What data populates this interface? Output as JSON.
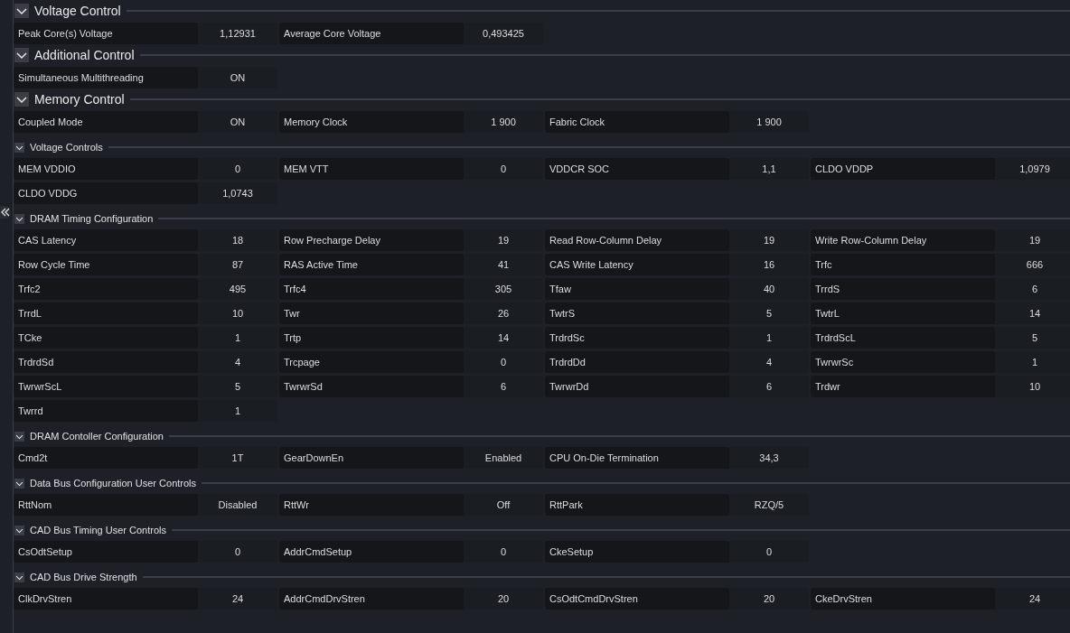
{
  "sections": [
    {
      "title": "Voltage Control",
      "kind": "major",
      "expanded": true,
      "items": [
        {
          "label": "Peak Core(s) Voltage",
          "value": "1,12931"
        },
        {
          "label": "Average Core Voltage",
          "value": "0,493425"
        }
      ]
    },
    {
      "title": "Additional Control",
      "kind": "major",
      "expanded": true,
      "items": [
        {
          "label": "Simultaneous Multithreading",
          "value": "ON"
        }
      ]
    },
    {
      "title": "Memory Control",
      "kind": "major",
      "expanded": true,
      "items": [
        {
          "label": "Coupled Mode",
          "value": "ON"
        },
        {
          "label": "Memory Clock",
          "value": "1 900"
        },
        {
          "label": "Fabric Clock",
          "value": "1 900"
        }
      ]
    },
    {
      "title": "Voltage Controls",
      "kind": "minor",
      "expanded": true,
      "items": [
        {
          "label": "MEM VDDIO",
          "value": "0"
        },
        {
          "label": "MEM VTT",
          "value": "0"
        },
        {
          "label": "VDDCR SOC",
          "value": "1,1"
        },
        {
          "label": "CLDO VDDP",
          "value": "1,0979"
        },
        {
          "label": "CLDO VDDG",
          "value": "1,0743"
        }
      ]
    },
    {
      "title": "DRAM Timing Configuration",
      "kind": "minor",
      "expanded": true,
      "items": [
        {
          "label": "CAS Latency",
          "value": "18"
        },
        {
          "label": "Row Precharge Delay",
          "value": "19"
        },
        {
          "label": "Read Row-Column Delay",
          "value": "19"
        },
        {
          "label": "Write Row-Column Delay",
          "value": "19"
        },
        {
          "label": "Row Cycle Time",
          "value": "87"
        },
        {
          "label": "RAS Active Time",
          "value": "41"
        },
        {
          "label": "CAS Write Latency",
          "value": "16"
        },
        {
          "label": "Trfc",
          "value": "666"
        },
        {
          "label": "Trfc2",
          "value": "495"
        },
        {
          "label": "Trfc4",
          "value": "305"
        },
        {
          "label": "Tfaw",
          "value": "40"
        },
        {
          "label": "TrrdS",
          "value": "6"
        },
        {
          "label": "TrrdL",
          "value": "10"
        },
        {
          "label": "Twr",
          "value": "26"
        },
        {
          "label": "TwtrS",
          "value": "5"
        },
        {
          "label": "TwtrL",
          "value": "14"
        },
        {
          "label": "TCke",
          "value": "1"
        },
        {
          "label": "Trtp",
          "value": "14"
        },
        {
          "label": "TrdrdSc",
          "value": "1"
        },
        {
          "label": "TrdrdScL",
          "value": "5"
        },
        {
          "label": "TrdrdSd",
          "value": "4"
        },
        {
          "label": "Trcpage",
          "value": "0"
        },
        {
          "label": "TrdrdDd",
          "value": "4"
        },
        {
          "label": "TwrwrSc",
          "value": "1"
        },
        {
          "label": "TwrwrScL",
          "value": "5"
        },
        {
          "label": "TwrwrSd",
          "value": "6"
        },
        {
          "label": "TwrwrDd",
          "value": "6"
        },
        {
          "label": "Trdwr",
          "value": "10"
        },
        {
          "label": "Twrrd",
          "value": "1"
        }
      ]
    },
    {
      "title": "DRAM Contoller Configuration",
      "kind": "minor",
      "expanded": true,
      "items": [
        {
          "label": "Cmd2t",
          "value": "1T"
        },
        {
          "label": "GearDownEn",
          "value": "Enabled"
        },
        {
          "label": "CPU On-Die Termination",
          "value": "34,3"
        }
      ]
    },
    {
      "title": "Data Bus Configuration User Controls",
      "kind": "minor",
      "expanded": true,
      "items": [
        {
          "label": "RttNom",
          "value": "Disabled"
        },
        {
          "label": "RttWr",
          "value": "Off"
        },
        {
          "label": "RttPark",
          "value": "RZQ/5"
        }
      ]
    },
    {
      "title": "CAD Bus Timing User Controls",
      "kind": "minor",
      "expanded": true,
      "items": [
        {
          "label": "CsOdtSetup",
          "value": "0"
        },
        {
          "label": "AddrCmdSetup",
          "value": "0"
        },
        {
          "label": "CkeSetup",
          "value": "0"
        }
      ]
    },
    {
      "title": "CAD Bus Drive Strength",
      "kind": "minor",
      "expanded": true,
      "items": [
        {
          "label": "ClkDrvStren",
          "value": "24"
        },
        {
          "label": "AddrCmdDrvStren",
          "value": "20"
        },
        {
          "label": "CsOdtCmdDrvStren",
          "value": "20"
        },
        {
          "label": "CkeDrvStren",
          "value": "24"
        }
      ]
    }
  ]
}
